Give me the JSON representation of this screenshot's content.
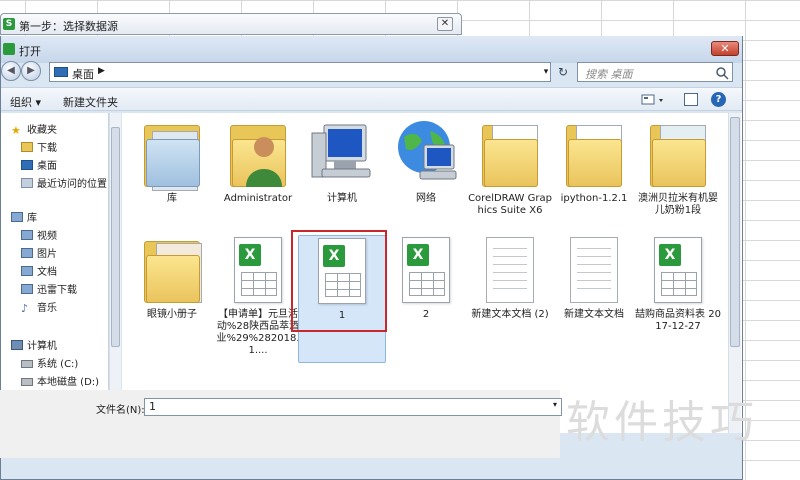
{
  "wizard": {
    "title": "第一步：选择数据源",
    "close_label": "✕"
  },
  "dialog": {
    "title": "打开",
    "close_label": "✕"
  },
  "address": {
    "location": "桌面",
    "search_placeholder": "搜索 桌面"
  },
  "toolbar": {
    "organize_label": "组织 ▾",
    "new_folder_label": "新建文件夹",
    "help_label": "?"
  },
  "nav_pane": {
    "items": [
      {
        "label": "收藏夹",
        "icon": "star-icon"
      },
      {
        "label": "下载",
        "icon": "download-folder-icon"
      },
      {
        "label": "桌面",
        "icon": "desktop-icon"
      },
      {
        "label": "最近访问的位置",
        "icon": "recent-places-icon"
      },
      {
        "label": "库",
        "icon": "library-icon"
      },
      {
        "label": "视频",
        "icon": "video-library-icon"
      },
      {
        "label": "图片",
        "icon": "picture-library-icon"
      },
      {
        "label": "文档",
        "icon": "document-library-icon"
      },
      {
        "label": "迅雷下载",
        "icon": "thunder-download-icon"
      },
      {
        "label": "音乐",
        "icon": "music-library-icon"
      },
      {
        "label": "计算机",
        "icon": "computer-icon"
      },
      {
        "label": "系统 (C:)",
        "icon": "drive-icon"
      },
      {
        "label": "本地磁盘 (D:)",
        "icon": "drive-icon"
      }
    ]
  },
  "files": [
    {
      "label": "库",
      "type": "library"
    },
    {
      "label": "Administrator",
      "type": "user"
    },
    {
      "label": "计算机",
      "type": "computer"
    },
    {
      "label": "网络",
      "type": "network"
    },
    {
      "label": "CorelDRAW Graphics Suite X6",
      "type": "folder"
    },
    {
      "label": "ipython-1.2.1",
      "type": "folder"
    },
    {
      "label": "澳洲贝拉米有机婴儿奶粉1段",
      "type": "folder"
    },
    {
      "label": "眼镜小册子",
      "type": "folder"
    },
    {
      "label": "【申请单】元旦活动%28陕西品萃酒业%29%282018.1....",
      "type": "excel"
    },
    {
      "label": "1",
      "type": "excel"
    },
    {
      "label": "2",
      "type": "excel"
    },
    {
      "label": "新建文本文档 (2)",
      "type": "text"
    },
    {
      "label": "新建文本文档",
      "type": "text"
    },
    {
      "label": "喆购商品资料表 2017-12-27",
      "type": "excel"
    }
  ],
  "bottom": {
    "filename_label": "文件名(N):",
    "filename_value": "1"
  },
  "watermark": "软件技巧",
  "colors": {
    "excel_green": "#2b9a3d",
    "selection": "#d5e6f8",
    "highlight_red": "#c8282c"
  }
}
